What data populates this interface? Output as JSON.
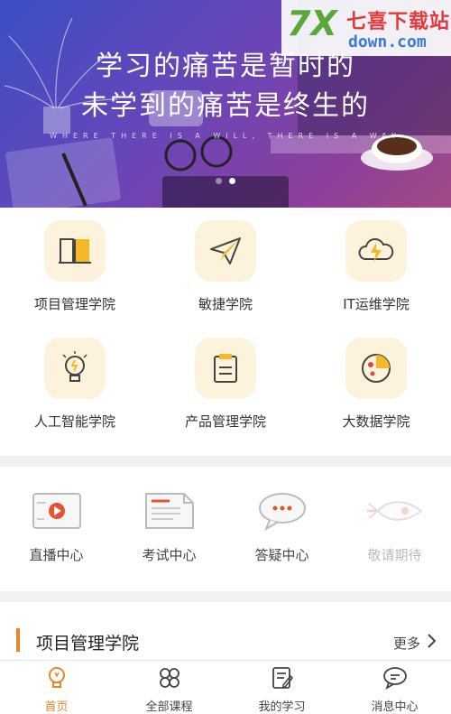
{
  "banner": {
    "slogan_line1": "学习的痛苦是暂时的",
    "slogan_line2": "未学到的痛苦是终生的",
    "slogan_en": "WHERE THERE IS A WILL, THERE IS A WAY",
    "dots": 2,
    "active_dot": 2
  },
  "watermark": {
    "brand_mark": "7X",
    "brand_cn": "七喜下载站",
    "brand_url": "down.com"
  },
  "academies": [
    {
      "label": "项目管理学院",
      "icon": "book-icon"
    },
    {
      "label": "敏捷学院",
      "icon": "paper-plane-icon"
    },
    {
      "label": "IT运维学院",
      "icon": "cloud-lightning-icon"
    },
    {
      "label": "人工智能学院",
      "icon": "lightbulb-icon"
    },
    {
      "label": "产品管理学院",
      "icon": "clipboard-icon"
    },
    {
      "label": "大数据学院",
      "icon": "pie-chart-icon"
    }
  ],
  "services": [
    {
      "label": "直播中心",
      "icon": "live-video-icon",
      "enabled": true
    },
    {
      "label": "考试中心",
      "icon": "exam-paper-icon",
      "enabled": true
    },
    {
      "label": "答疑中心",
      "icon": "chat-bubble-icon",
      "enabled": true
    },
    {
      "label": "敬请期待",
      "icon": "rocket-icon",
      "enabled": false
    }
  ],
  "section": {
    "title": "项目管理学院",
    "more": "更多"
  },
  "tabs": [
    {
      "label": "首页",
      "icon": "lightbulb-icon",
      "active": true
    },
    {
      "label": "全部课程",
      "icon": "four-leaf-icon",
      "active": false
    },
    {
      "label": "我的学习",
      "icon": "notebook-pen-icon",
      "active": false
    },
    {
      "label": "消息中心",
      "icon": "message-bubble-icon",
      "active": false
    }
  ],
  "colors": {
    "accent": "#e8862a",
    "tile_bg": "#fdf3dd",
    "separator": "#f1f1f1"
  }
}
